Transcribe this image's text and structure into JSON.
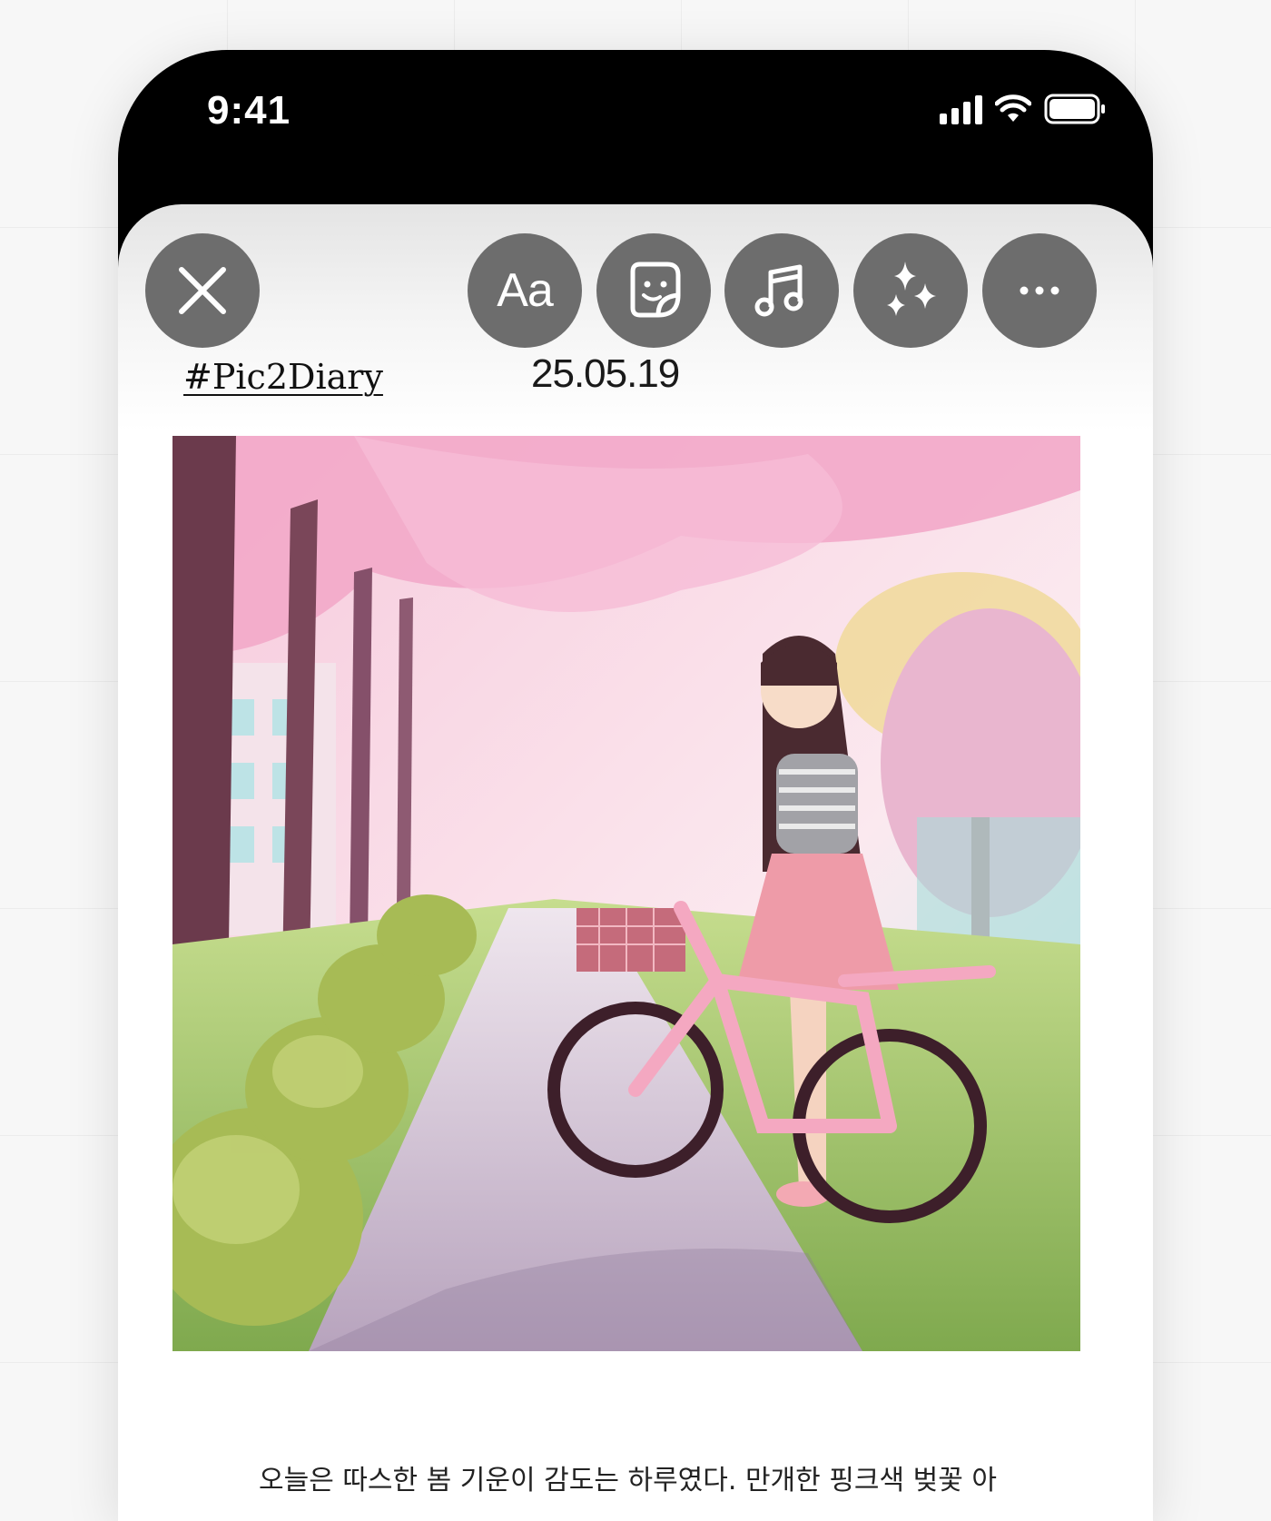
{
  "status_bar": {
    "time": "9:41",
    "icons": [
      "cellular-signal-icon",
      "wifi-icon",
      "battery-icon"
    ]
  },
  "toolbar": {
    "close_icon": "close-icon",
    "text_button_label": "Aa",
    "buttons": [
      "text-button",
      "sticker-button",
      "music-button",
      "effects-button",
      "more-button"
    ],
    "button_color": "#6d6d6d"
  },
  "diary": {
    "hashtag": "#Pic2Diary",
    "date": "25.05.19",
    "image_description_icon": "diary-illustration",
    "text": "오늘은 따스한 봄 기운이 감도는 하루였다. 만개한 핑크색 벚꽃 아"
  }
}
